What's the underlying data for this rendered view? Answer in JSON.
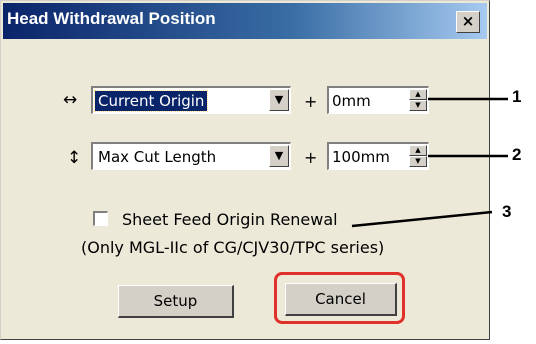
{
  "dialog": {
    "title": "Head Withdrawal Position",
    "close_glyph": "×"
  },
  "row1": {
    "direction_symbol": "↔",
    "origin_value": "Current Origin",
    "plus": "+",
    "offset_value": "0mm"
  },
  "row2": {
    "direction_symbol": "↕",
    "origin_value": "Max Cut Length",
    "plus": "+",
    "offset_value": "100mm"
  },
  "sheet_feed": {
    "label": "Sheet Feed Origin Renewal",
    "checked": false,
    "note": "(Only MGL-IIc of CG/CJV30/TPC series)"
  },
  "buttons": {
    "setup_label": "Setup",
    "cancel_label": "Cancel"
  },
  "callouts": [
    "1",
    "2",
    "3"
  ],
  "colors": {
    "titlebar_start": "#0a246a",
    "titlebar_end": "#a6caf0",
    "highlight": "#e0302a",
    "dialog_bg": "#ece9d8"
  }
}
